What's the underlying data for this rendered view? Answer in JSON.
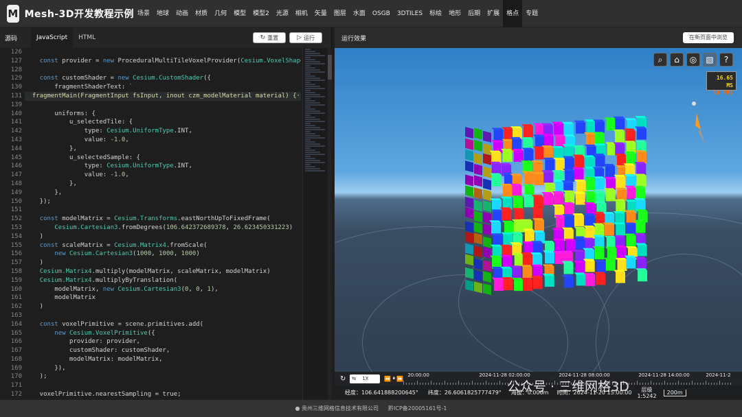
{
  "brand": {
    "logo_mark": "M",
    "title": "Mesh-3D开发教程示例"
  },
  "nav": [
    "场景",
    "地球",
    "动画",
    "材质",
    "几何",
    "模型",
    "模型2",
    "光源",
    "相机",
    "矢量",
    "图层",
    "水面",
    "OSGB",
    "3DTILES",
    "标绘",
    "地形",
    "后期",
    "扩展",
    "格点",
    "专题"
  ],
  "nav_active_index": 18,
  "left": {
    "source_label": "源码",
    "tab_js": "JavaScript",
    "tab_html": "HTML",
    "reset_label": "重置",
    "run_label": "运行"
  },
  "code": {
    "lines": [
      {
        "n": "126",
        "t": ""
      },
      {
        "n": "127",
        "t": "    const provider = new ProceduralMultiTileVoxelProvider(Cesium.VoxelShape"
      },
      {
        "n": "128",
        "t": ""
      },
      {
        "n": "129",
        "t": "    const customShader = new Cesium.CustomShader({"
      },
      {
        "n": "130",
        "t": "        fragmentShaderText: `"
      },
      {
        "n": "131",
        "t": "  fragmentMain(FragmentInput fsInput, inout czm_modelMaterial material) {···"
      },
      {
        "n": "139",
        "t": ""
      },
      {
        "n": "140",
        "t": "        uniforms: {"
      },
      {
        "n": "141",
        "t": "            u_selectedTile: {"
      },
      {
        "n": "142",
        "t": "                type: Cesium.UniformType.INT,"
      },
      {
        "n": "143",
        "t": "                value: -1.0,"
      },
      {
        "n": "144",
        "t": "            },"
      },
      {
        "n": "145",
        "t": "            u_selectedSample: {"
      },
      {
        "n": "146",
        "t": "                type: Cesium.UniformType.INT,"
      },
      {
        "n": "147",
        "t": "                value: -1.0,"
      },
      {
        "n": "148",
        "t": "            },"
      },
      {
        "n": "149",
        "t": "        },"
      },
      {
        "n": "150",
        "t": "    });"
      },
      {
        "n": "151",
        "t": ""
      },
      {
        "n": "152",
        "t": "    const modelMatrix = Cesium.Transforms.eastNorthUpToFixedFrame("
      },
      {
        "n": "153",
        "t": "        Cesium.Cartesian3.fromDegrees(106.642372689378, 26.623450331223)"
      },
      {
        "n": "154",
        "t": "    )"
      },
      {
        "n": "155",
        "t": "    const scaleMatrix = Cesium.Matrix4.fromScale("
      },
      {
        "n": "156",
        "t": "        new Cesium.Cartesian3(1000, 1000, 1000)"
      },
      {
        "n": "157",
        "t": "    )"
      },
      {
        "n": "158",
        "t": "    Cesium.Matrix4.multiply(modelMatrix, scaleMatrix, modelMatrix)"
      },
      {
        "n": "159",
        "t": "    Cesium.Matrix4.multiplyByTranslation("
      },
      {
        "n": "160",
        "t": "        modelMatrix, new Cesium.Cartesian3(0, 0, 1),"
      },
      {
        "n": "161",
        "t": "        modelMatrix"
      },
      {
        "n": "162",
        "t": "    )"
      },
      {
        "n": "163",
        "t": ""
      },
      {
        "n": "164",
        "t": "    const voxelPrimitive = scene.primitives.add("
      },
      {
        "n": "165",
        "t": "        new Cesium.VoxelPrimitive({"
      },
      {
        "n": "166",
        "t": "            provider: provider,"
      },
      {
        "n": "167",
        "t": "            customShader: customShader,"
      },
      {
        "n": "168",
        "t": "            modelMatrix: modelMatrix,"
      },
      {
        "n": "169",
        "t": "        }),"
      },
      {
        "n": "170",
        "t": "    );"
      },
      {
        "n": "171",
        "t": ""
      },
      {
        "n": "172",
        "t": "    voxelPrimitive.nearestSampling = true;"
      }
    ]
  },
  "right": {
    "title": "运行效果",
    "open_new_label": "在新页面中浏览"
  },
  "viewer": {
    "tools": [
      "search-icon",
      "home-icon",
      "globe-icon",
      "layers-icon",
      "help-icon"
    ],
    "tool_glyphs": [
      "⌕",
      "⌂",
      "◎",
      "▧",
      "?"
    ],
    "fps_ms": "16.65 MS",
    "fps_fps": "59 FPS",
    "voxel_colors": [
      "#ff2020",
      "#ffe01a",
      "#1aff1a",
      "#1ad8ff",
      "#2244ff",
      "#ff1ad8",
      "#8822ff",
      "#ff8a1a",
      "#22ff9a",
      "#9aff22",
      "#00e0c0",
      "#d000ff"
    ]
  },
  "timeline": {
    "speed": "1X",
    "speed_prefix": "⇆",
    "times": [
      "20:00:00",
      "2024-11-28 02:00:00",
      "2024-11-28 08:00:00",
      "2024-11-28 14:00:00",
      "2024-11-2"
    ]
  },
  "status": {
    "lon": "经度：106.641888200645°",
    "lat": "纬度：26.6061825777479°",
    "alt": "海拔：0.000m",
    "time": "时间：2024-11-20 15:00:00",
    "level": "层级",
    "scale_ratio": "1:5242",
    "scale_len": "200m"
  },
  "footer": {
    "company": "贵州三维网格信息技术有限公司",
    "icp": "黔ICP备20005161号-1"
  },
  "watermark": "公众号 · 三维网格3D"
}
